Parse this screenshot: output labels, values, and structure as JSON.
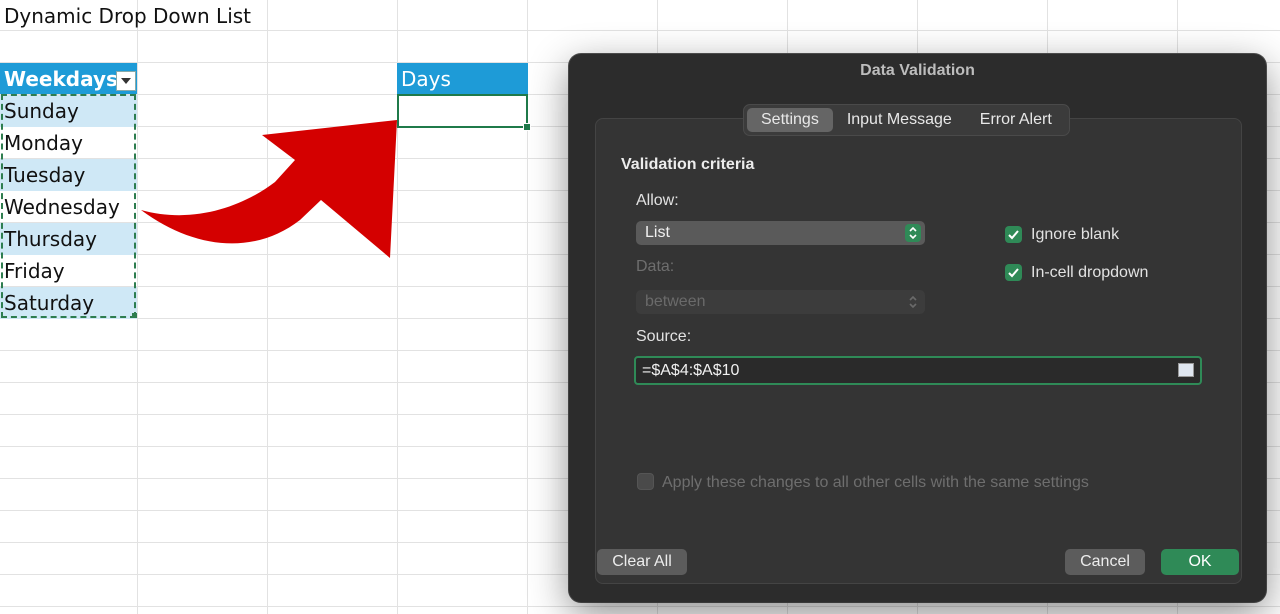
{
  "sheet": {
    "title": "Dynamic Drop Down List",
    "weekdays_header": "Weekdays",
    "weekdays": [
      "Sunday",
      "Monday",
      "Tuesday",
      "Wednesday",
      "Thursday",
      "Friday",
      "Saturday"
    ],
    "days_header": "Days"
  },
  "dialog": {
    "title": "Data Validation",
    "tabs": [
      "Settings",
      "Input Message",
      "Error Alert"
    ],
    "active_tab": "Settings",
    "section_title": "Validation criteria",
    "allow_label": "Allow:",
    "allow_value": "List",
    "data_label": "Data:",
    "data_value": "between",
    "ignore_blank_label": "Ignore blank",
    "ignore_blank_checked": true,
    "in_cell_dropdown_label": "In-cell dropdown",
    "in_cell_dropdown_checked": true,
    "source_label": "Source:",
    "source_value": "=$A$4:$A$10",
    "apply_all_label": "Apply these changes to all other cells with the same settings",
    "apply_all_checked": false,
    "clear_all_label": "Clear All",
    "cancel_label": "Cancel",
    "ok_label": "OK"
  },
  "colors": {
    "header_blue": "#1e9bd7",
    "band_blue": "#cfe8f6",
    "accent_green": "#2f8a57",
    "arrow_red": "#d40000"
  }
}
